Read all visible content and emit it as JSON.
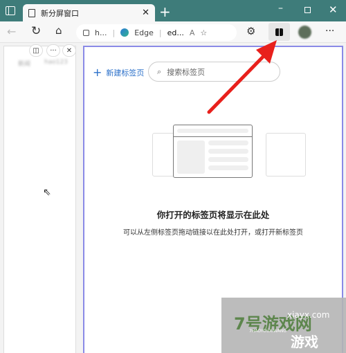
{
  "tab": {
    "title": "新分屏窗口"
  },
  "toolbar": {
    "address_host": "h...",
    "edge_label": "Edge",
    "address_suffix": "ed..."
  },
  "left_pane": {
    "blurred_text_1": "新闻",
    "blurred_text_2": "hao123"
  },
  "right_pane": {
    "new_tab_label": "新建标签页",
    "search_placeholder": "搜索标签页",
    "heading": "你打开的标签页将显示在此处",
    "description": "可以从左侧标签页拖动链接以在此处打开，或打开新标签页"
  },
  "watermark": {
    "text": "7号游戏网",
    "url": "xiayx.com",
    "pinyin": "7HAOYOUXIWANG",
    "sub": "游戏"
  },
  "colors": {
    "titlebar": "#3e7c7a",
    "pane_border": "#8a8ae6",
    "accent": "#2a6fc9",
    "arrow": "#e8201c"
  }
}
